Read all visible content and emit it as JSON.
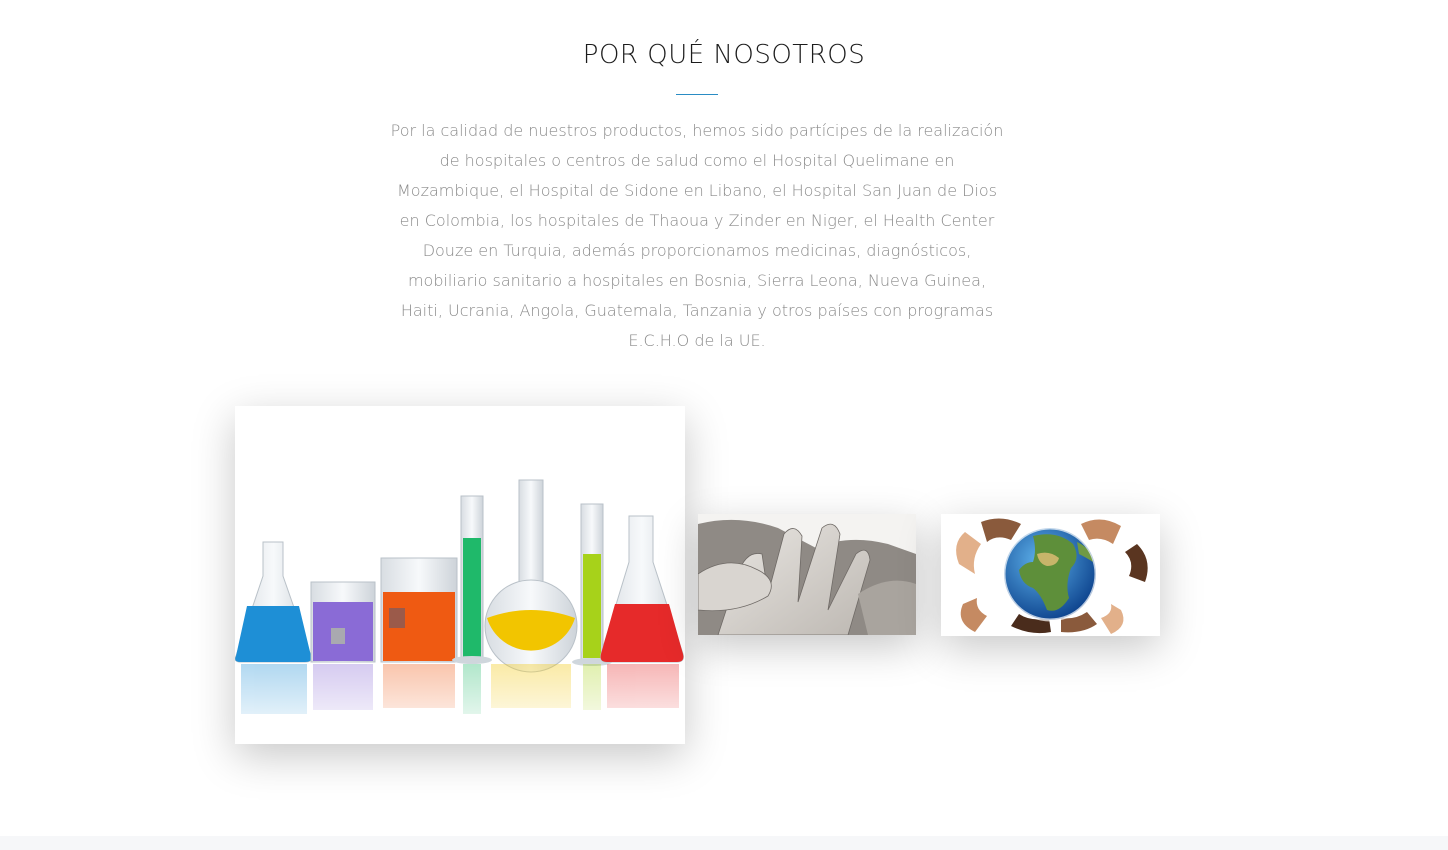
{
  "section": {
    "title": "POR QUÉ NOSOTROS",
    "paragraph": "Por la calidad de nuestros productos, hemos sido partícipes de la realización de hospitales o centros de salud como el Hospital Quelimane en Mozambique, el Hospital de Sidone en Libano, el Hospital San Juan de Dios en Colombia, los hospitales de Thaoua y Zinder en Niger, el Health Center Douze en Turquia, además proporcionamos medicinas, diagnósticos, mobiliario sanitario a hospitales en Bosnia, Sierra Leona, Nueva Guinea, Haiti, Ucrania, Angola, Guatemala, Tanzania y otros países con programas E.C.H.O de la UE."
  },
  "colors": {
    "accent": "#2a8cc4",
    "title_text": "#1c1c1c",
    "body_text": "#8a8a8a",
    "footer_bg": "#f6f7f9"
  },
  "gallery": {
    "images": [
      {
        "name": "laboratory-glassware-photo"
      },
      {
        "name": "hands-photo"
      },
      {
        "name": "hands-around-globe-photo"
      }
    ]
  }
}
